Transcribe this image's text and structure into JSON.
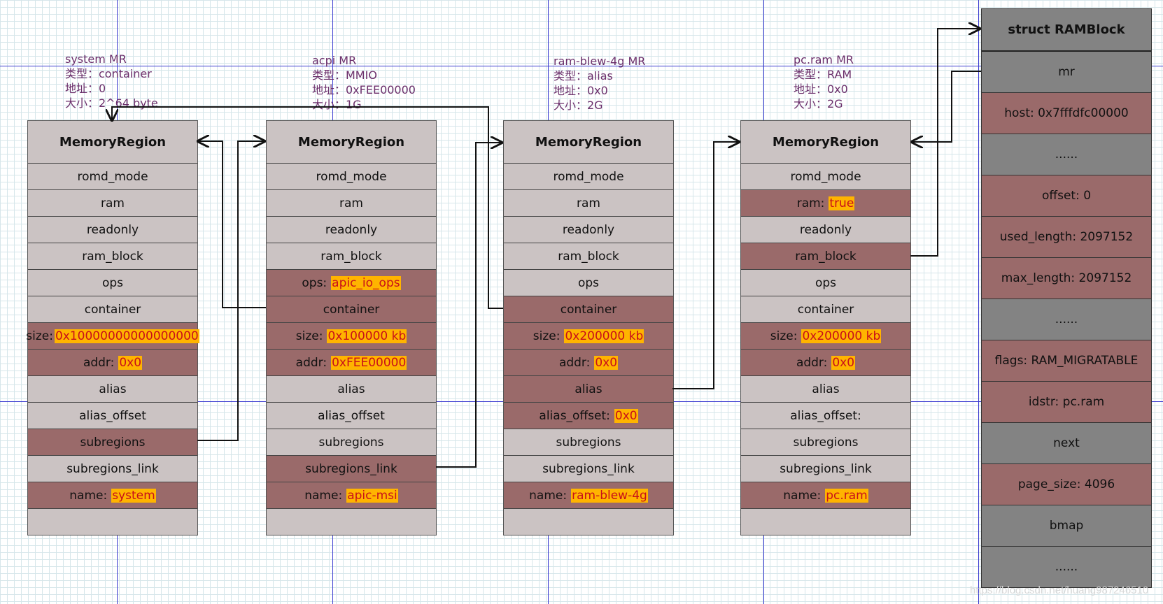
{
  "regions": [
    {
      "caption": [
        "system MR",
        "类型：container",
        "地址：0",
        "大小：2^64 byte"
      ],
      "title": "MemoryRegion",
      "rows": [
        {
          "label": "romd_mode",
          "value": "",
          "hl": false
        },
        {
          "label": "ram",
          "value": "",
          "hl": false
        },
        {
          "label": "readonly",
          "value": "",
          "hl": false
        },
        {
          "label": "ram_block",
          "value": "",
          "hl": false
        },
        {
          "label": "ops",
          "value": "",
          "hl": false
        },
        {
          "label": "container",
          "value": "",
          "hl": false
        },
        {
          "label": "size:",
          "value": "0x10000000000000000",
          "hl": true
        },
        {
          "label": "addr:",
          "value": "0x0",
          "hl": true
        },
        {
          "label": "alias",
          "value": "",
          "hl": false
        },
        {
          "label": "alias_offset",
          "value": "",
          "hl": false
        },
        {
          "label": "subregions",
          "value": "",
          "hl": true
        },
        {
          "label": "subregions_link",
          "value": "",
          "hl": false
        },
        {
          "label": "name:",
          "value": "system",
          "hl": true
        },
        {
          "label": "",
          "value": "",
          "hl": false
        }
      ]
    },
    {
      "caption": [
        "acpi MR",
        "类型：MMIO",
        "地址：0xFEE00000",
        "大小：1G"
      ],
      "title": "MemoryRegion",
      "rows": [
        {
          "label": "romd_mode",
          "value": "",
          "hl": false
        },
        {
          "label": "ram",
          "value": "",
          "hl": false
        },
        {
          "label": "readonly",
          "value": "",
          "hl": false
        },
        {
          "label": "ram_block",
          "value": "",
          "hl": false
        },
        {
          "label": "ops:",
          "value": "apic_io_ops",
          "hl": true
        },
        {
          "label": "container",
          "value": "",
          "hl": true
        },
        {
          "label": "size:",
          "value": "0x100000 kb",
          "hl": true
        },
        {
          "label": "addr:",
          "value": "0xFEE00000",
          "hl": true
        },
        {
          "label": "alias",
          "value": "",
          "hl": false
        },
        {
          "label": "alias_offset",
          "value": "",
          "hl": false
        },
        {
          "label": "subregions",
          "value": "",
          "hl": false
        },
        {
          "label": "subregions_link",
          "value": "",
          "hl": true
        },
        {
          "label": "name:",
          "value": "apic-msi",
          "hl": true
        },
        {
          "label": "",
          "value": "",
          "hl": false
        }
      ]
    },
    {
      "caption": [
        "ram-blew-4g MR",
        "类型：alias",
        "地址：0x0",
        "大小：2G"
      ],
      "title": "MemoryRegion",
      "rows": [
        {
          "label": "romd_mode",
          "value": "",
          "hl": false
        },
        {
          "label": "ram",
          "value": "",
          "hl": false
        },
        {
          "label": "readonly",
          "value": "",
          "hl": false
        },
        {
          "label": "ram_block",
          "value": "",
          "hl": false
        },
        {
          "label": "ops",
          "value": "",
          "hl": false
        },
        {
          "label": "container",
          "value": "",
          "hl": true
        },
        {
          "label": "size:",
          "value": "0x200000 kb",
          "hl": true
        },
        {
          "label": "addr:",
          "value": "0x0",
          "hl": true
        },
        {
          "label": "alias",
          "value": "",
          "hl": true
        },
        {
          "label": "alias_offset:",
          "value": "0x0",
          "hl": true
        },
        {
          "label": "subregions",
          "value": "",
          "hl": false
        },
        {
          "label": "subregions_link",
          "value": "",
          "hl": false
        },
        {
          "label": "name:",
          "value": "ram-blew-4g",
          "hl": true
        },
        {
          "label": "",
          "value": "",
          "hl": false
        }
      ]
    },
    {
      "caption": [
        "pc.ram MR",
        "类型：RAM",
        "地址：0x0",
        "大小：2G"
      ],
      "title": "MemoryRegion",
      "rows": [
        {
          "label": "romd_mode",
          "value": "",
          "hl": false
        },
        {
          "label": "ram:",
          "value": "true",
          "hl": true
        },
        {
          "label": "readonly",
          "value": "",
          "hl": false
        },
        {
          "label": "ram_block",
          "value": "",
          "hl": true
        },
        {
          "label": "ops",
          "value": "",
          "hl": false
        },
        {
          "label": "container",
          "value": "",
          "hl": false
        },
        {
          "label": "size:",
          "value": "0x200000 kb",
          "hl": true
        },
        {
          "label": "addr:",
          "value": "0x0",
          "hl": true
        },
        {
          "label": "alias",
          "value": "",
          "hl": false
        },
        {
          "label": "alias_offset:",
          "value": "",
          "hl": false
        },
        {
          "label": "subregions",
          "value": "",
          "hl": false
        },
        {
          "label": "subregions_link",
          "value": "",
          "hl": false
        },
        {
          "label": "name:",
          "value": "pc.ram",
          "hl": true
        },
        {
          "label": "",
          "value": "",
          "hl": false
        }
      ]
    }
  ],
  "ramblock": {
    "title": "struct RAMBlock",
    "rows": [
      {
        "label": "mr",
        "tone": "dark"
      },
      {
        "label": "host: 0x7fffdfc00000",
        "tone": "red"
      },
      {
        "label": "......",
        "tone": "dark"
      },
      {
        "label": "offset: 0",
        "tone": "red"
      },
      {
        "label": "used_length: 2097152",
        "tone": "red"
      },
      {
        "label": "max_length: 2097152",
        "tone": "red"
      },
      {
        "label": "......",
        "tone": "dark"
      },
      {
        "label": "flags: RAM_MIGRATABLE",
        "tone": "red"
      },
      {
        "label": "idstr: pc.ram",
        "tone": "red"
      },
      {
        "label": "next",
        "tone": "dark"
      },
      {
        "label": "page_size: 4096",
        "tone": "red"
      },
      {
        "label": "bmap",
        "tone": "dark"
      },
      {
        "label": "......",
        "tone": "dark"
      }
    ]
  },
  "watermark": "https://blog.csdn.net/huang987246510",
  "colors": {
    "cell_light": "#cbc3c3",
    "cell_highlight": "#9a6a6a",
    "cell_dark": "#838383",
    "value_background": "#ffb400",
    "value_text": "#c8101a",
    "caption_text": "#6b2f6b",
    "guide_line": "#3b3bd0"
  }
}
